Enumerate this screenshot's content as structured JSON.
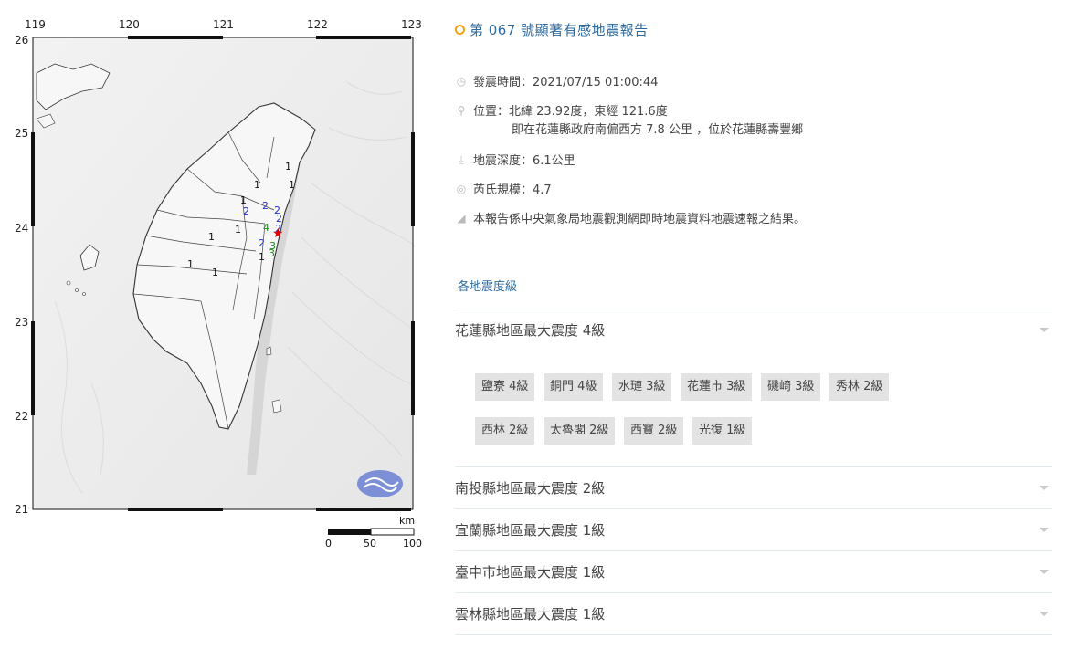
{
  "map": {
    "lon_ticks": [
      "119",
      "120",
      "121",
      "122",
      "123"
    ],
    "lat_ticks": [
      "26",
      "25",
      "24",
      "23",
      "22",
      "21"
    ],
    "scale": {
      "unit": "km",
      "labels": [
        "0",
        "50",
        "100"
      ]
    },
    "intensity_marks": [
      "1",
      "1",
      "1",
      "1",
      "2",
      "2",
      "2",
      "2",
      "4",
      "2",
      "1",
      "1",
      "2",
      "3",
      "3",
      "1",
      "1",
      "1"
    ],
    "epicenter": "epicenter-star"
  },
  "report": {
    "title": "第 067 號顯著有感地震報告",
    "origin_time": "發震時間：2021/07/15 01:00:44",
    "location_line1": "位置：北緯 23.92度，東經 121.6度",
    "location_line2": "即在花蓮縣政府南偏西方 7.8 公里 ，位於花蓮縣壽豐鄉",
    "depth": "地震深度：6.1公里",
    "magnitude": "芮氏規模：4.7",
    "note": "本報告係中央氣象局地震觀測網即時地震資料地震速報之結果。",
    "section_title": "各地震度級",
    "counties": [
      {
        "label": "花蓮縣地區最大震度 4級"
      },
      {
        "label": "南投縣地區最大震度 2級"
      },
      {
        "label": "宜蘭縣地區最大震度 1級"
      },
      {
        "label": "臺中市地區最大震度 1級"
      },
      {
        "label": "雲林縣地區最大震度 1級"
      }
    ],
    "hualien_stations": [
      "鹽寮 4級",
      "銅門 4級",
      "水璉 3級",
      "花蓮市 3級",
      "磯崎 3級",
      "秀林 2級",
      "西林 2級",
      "太魯閣 2級",
      "西寶 2級",
      "光復 1級"
    ]
  },
  "colors": {
    "title": "#2d6a9f",
    "accent_dot": "#f2a20c",
    "chip_bg": "#e3e3e3",
    "divider": "#e3eaee",
    "intensity_1": "#111111",
    "intensity_2": "#2233cc",
    "intensity_3": "#228822",
    "intensity_4": "#228822",
    "epicenter": "#e00000"
  },
  "icons": {
    "time": "clock-icon",
    "location": "map-pin-icon",
    "depth": "depth-icon",
    "magnitude": "wave-icon",
    "note": "megaphone-icon"
  }
}
